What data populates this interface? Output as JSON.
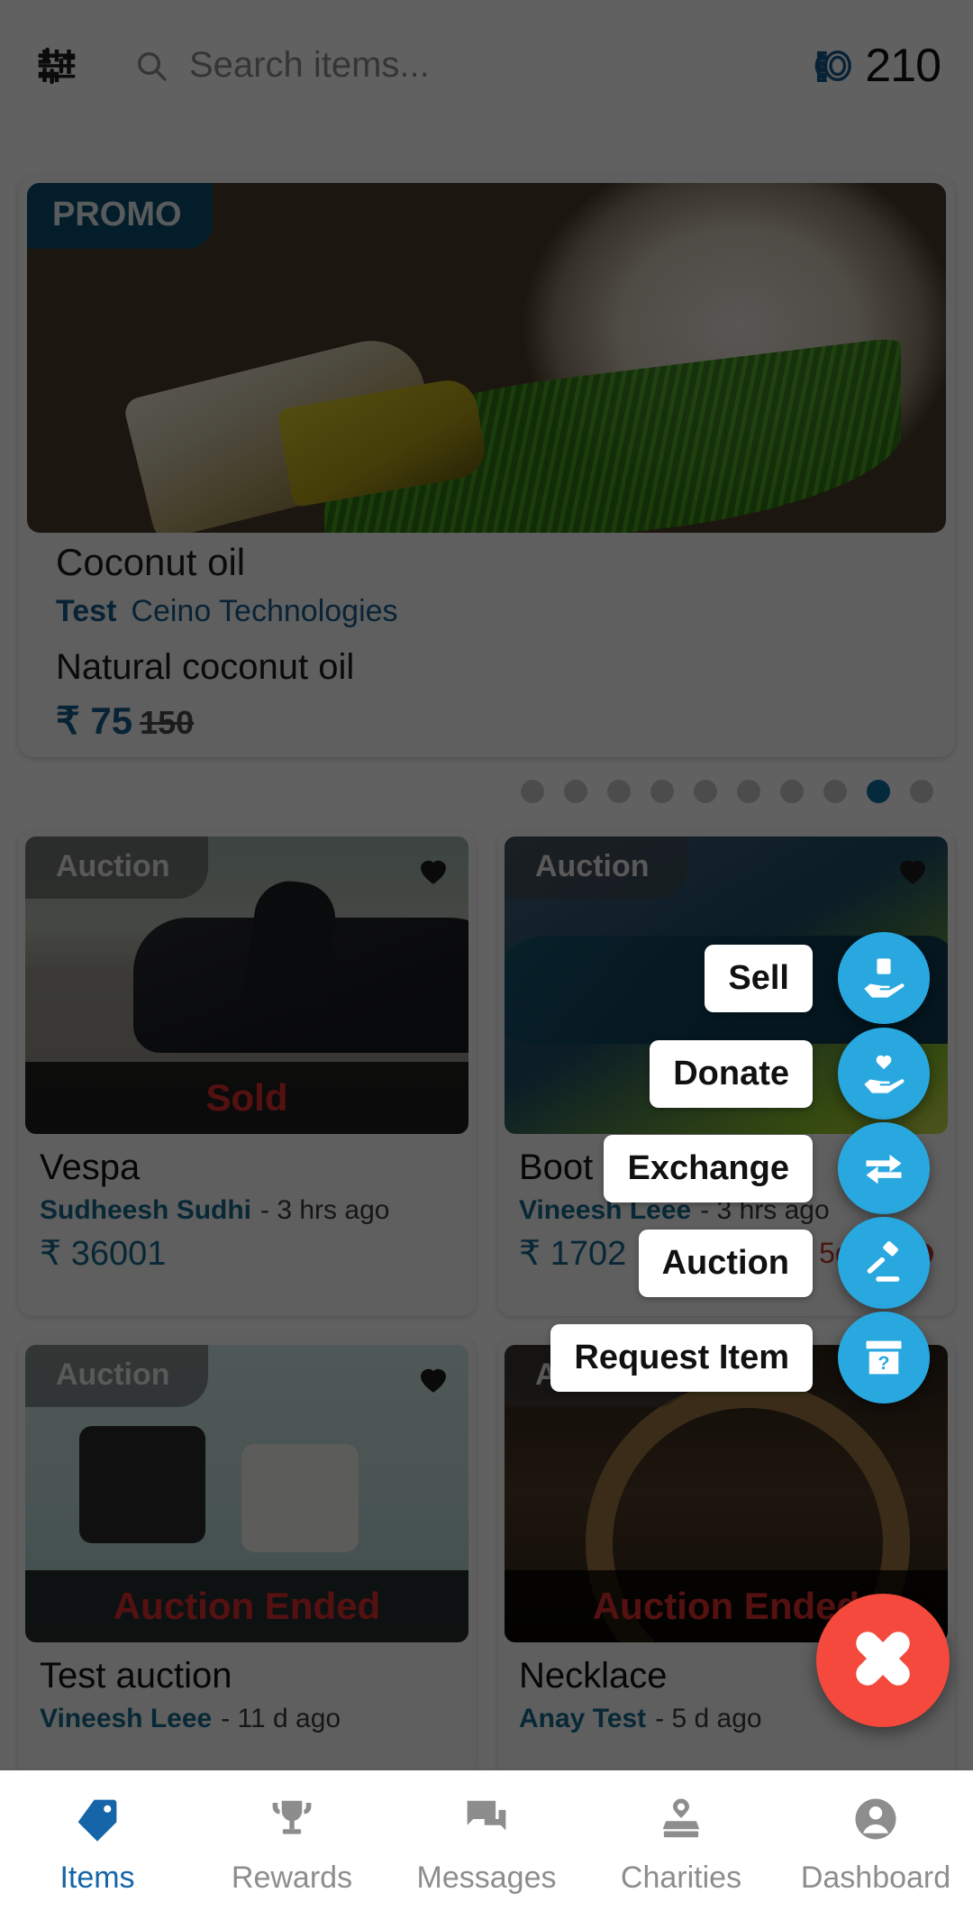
{
  "header": {
    "filter_icon": "tune-icon",
    "search_icon": "search-icon",
    "search_placeholder": "Search items...",
    "search_value": "",
    "coins_icon": "coins-icon",
    "coins_count": "210"
  },
  "promo": {
    "badge": "PROMO",
    "title": "Coconut oil",
    "tag": "Test",
    "org": "Ceino Technologies",
    "description": "Natural coconut oil",
    "currency": "₹",
    "price": "75",
    "old_price": "150"
  },
  "carousel": {
    "total_dots": 10,
    "active_index": 8
  },
  "items": [
    {
      "badge": "Auction",
      "status": "Sold",
      "title": "Vespa",
      "seller": "Sudheesh Sudhi",
      "time": "- 3 hrs ago",
      "price": "₹ 36001",
      "countdown": "",
      "image": "vespa-scooter"
    },
    {
      "badge": "Auction",
      "status": "",
      "title": "Boot",
      "seller": "Vineesh Leee",
      "time": "- 3 hrs ago",
      "price": "₹ 1702",
      "countdown": "5d 3m",
      "image": "football-boot"
    },
    {
      "badge": "Auction",
      "status": "Auction Ended",
      "title": "Test auction",
      "seller": "Vineesh Leee",
      "time": "- 11 d ago",
      "price": "",
      "countdown": "",
      "image": "vintage-cameras"
    },
    {
      "badge": "Auction",
      "status": "Auction Ended",
      "title": "Necklace",
      "seller": "Anay Test",
      "time": "- 5 d ago",
      "price": "",
      "countdown": "",
      "image": "necklace"
    }
  ],
  "speed_dial": {
    "actions": [
      {
        "label": "Sell",
        "icon": "hand-holding-document-icon"
      },
      {
        "label": "Donate",
        "icon": "hand-holding-heart-icon"
      },
      {
        "label": "Exchange",
        "icon": "exchange-arrows-icon"
      },
      {
        "label": "Auction",
        "icon": "gavel-icon"
      },
      {
        "label": "Request Item",
        "icon": "box-question-icon"
      }
    ],
    "close_icon": "close-icon",
    "fab_color": "#29a8e0",
    "close_color": "#f4493c"
  },
  "bottom_nav": {
    "active_color": "#1565a8",
    "inactive_color": "#8d8d8d",
    "items": [
      {
        "label": "Items",
        "icon": "tag-icon"
      },
      {
        "label": "Rewards",
        "icon": "trophy-icon"
      },
      {
        "label": "Messages",
        "icon": "chat-icon"
      },
      {
        "label": "Charities",
        "icon": "charity-box-icon"
      },
      {
        "label": "Dashboard",
        "icon": "account-circle-icon"
      }
    ]
  }
}
